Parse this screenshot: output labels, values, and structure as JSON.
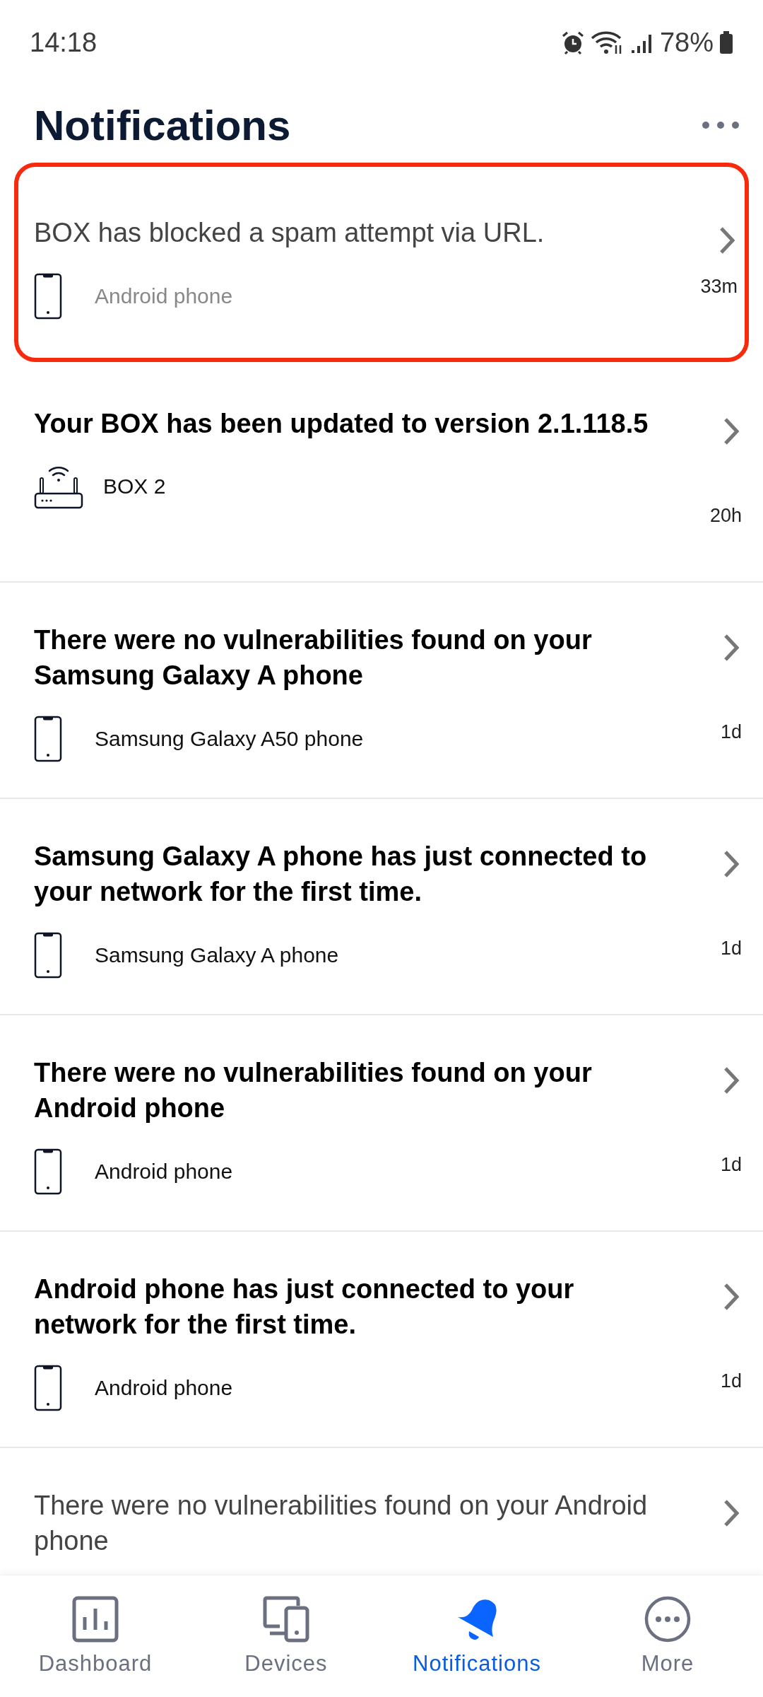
{
  "status_bar": {
    "time": "14:18",
    "battery": "78%"
  },
  "header": {
    "title": "Notifications"
  },
  "notifications": [
    {
      "title": "BOX has blocked a spam attempt via URL.",
      "unread": false,
      "highlighted": true,
      "device": {
        "kind": "phone",
        "name": "Android phone"
      },
      "time": "33m"
    },
    {
      "title": "Your BOX has been updated to version 2.1.118.5",
      "unread": true,
      "highlighted": false,
      "device": {
        "kind": "router",
        "name": "BOX 2"
      },
      "time": "20h"
    },
    {
      "title": "There were no vulnerabilities found on your Samsung Galaxy A phone",
      "unread": true,
      "highlighted": false,
      "device": {
        "kind": "phone",
        "name": "Samsung Galaxy A50 phone"
      },
      "time": "1d"
    },
    {
      "title": "Samsung Galaxy A phone has just connected to your network for the first time.",
      "unread": true,
      "highlighted": false,
      "device": {
        "kind": "phone",
        "name": "Samsung Galaxy A phone"
      },
      "time": "1d"
    },
    {
      "title": "There were no vulnerabilities found on your Android phone",
      "unread": true,
      "highlighted": false,
      "device": {
        "kind": "phone",
        "name": "Android phone"
      },
      "time": "1d"
    },
    {
      "title": "Android phone has just connected to your network for the first time.",
      "unread": true,
      "highlighted": false,
      "device": {
        "kind": "phone",
        "name": "Android phone"
      },
      "time": "1d"
    },
    {
      "title": "There were no vulnerabilities found on your Android phone",
      "unread": false,
      "highlighted": false
    }
  ],
  "bottom_nav": [
    {
      "kind": "dashboard",
      "label": "Dashboard",
      "selected": false
    },
    {
      "kind": "devices",
      "label": "Devices",
      "selected": false
    },
    {
      "kind": "notifications",
      "label": "Notifications",
      "selected": true
    },
    {
      "kind": "more",
      "label": "More",
      "selected": false
    }
  ]
}
